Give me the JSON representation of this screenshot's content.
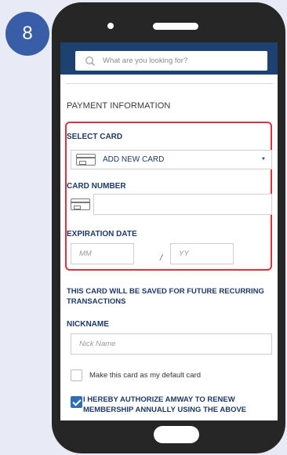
{
  "step": {
    "number": "8"
  },
  "search": {
    "placeholder": "What are you looking for?"
  },
  "payment": {
    "title": "PAYMENT INFORMATION",
    "select_card_label": "SELECT CARD",
    "select_card_value": "ADD NEW CARD",
    "card_number_label": "CARD NUMBER",
    "card_number_value": "",
    "expiration_label": "EXPIRATION DATE",
    "month_placeholder": "MM",
    "separator": "/",
    "year_placeholder": "YY"
  },
  "save_note": "THIS CARD WILL BE SAVED FOR FUTURE RECURRING TRANSACTIONS",
  "nickname": {
    "label": "NICKNAME",
    "placeholder": "Nick Name"
  },
  "default_card": {
    "label": "Make this card as my default card",
    "checked": false
  },
  "authorize": {
    "label": "I HEREBY AUTHORIZE AMWAY TO RENEW MEMBERSHIP ANNUALLY USING THE ABOVE",
    "checked": true
  },
  "colors": {
    "badge": "#3a5da8",
    "header": "#1d4170",
    "highlight": "#d9313f",
    "label": "#1f3a66",
    "check": "#2f6db5"
  }
}
